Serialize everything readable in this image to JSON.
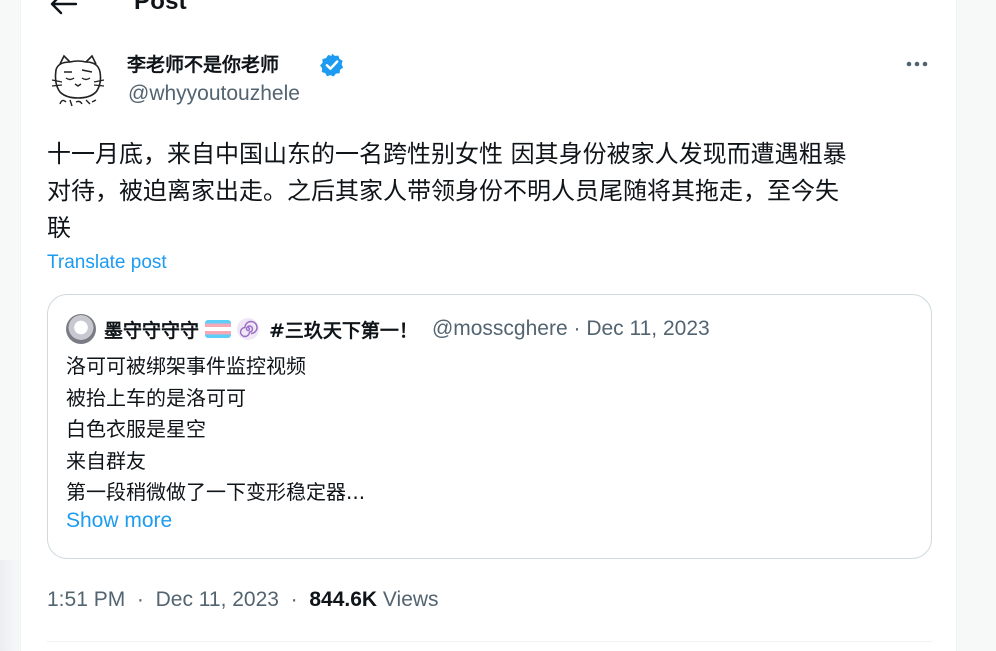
{
  "header": {
    "title": "Post",
    "back_icon": "arrow-left-icon"
  },
  "author": {
    "name": "李老师不是你老师",
    "handle": "@whyyoutouzhele",
    "verified": true,
    "verified_color": "#1d9bf0"
  },
  "post": {
    "text": "十一月底，来自中国山东的一名跨性别女性 因其身份被家人发现而遭遇粗暴\n对待，被迫离家出走。之后其家人带领身份不明人员尾随将其拖走，至今失\n联",
    "translate_label": "Translate post"
  },
  "quote": {
    "author_name": "墨守守守守",
    "hashtag": "#三玖天下第一！",
    "handle": "@mosscghere",
    "separator": "·",
    "date": "Dec 11, 2023",
    "body": "洛可可被绑架事件监控视频\n被抬上车的是洛可可\n白色衣服是星空\n来自群友\n第一段稍微做了一下变形稳定器...",
    "show_more_label": "Show more"
  },
  "meta": {
    "time": "1:51 PM",
    "separator": "·",
    "date": "Dec 11, 2023",
    "views_count": "844.6K",
    "views_label": "Views"
  },
  "colors": {
    "accent": "#1d9bf0",
    "secondary_text": "#536471",
    "border": "#cfd9de"
  }
}
